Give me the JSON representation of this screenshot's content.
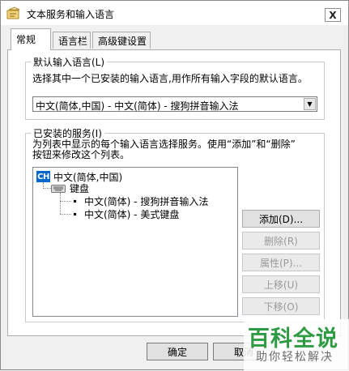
{
  "window": {
    "title": "文本服务和输入语言",
    "close_glyph": "X"
  },
  "tabs": [
    {
      "label": "常规",
      "active": true
    },
    {
      "label": "语言栏",
      "active": false
    },
    {
      "label": "高级键设置",
      "active": false
    }
  ],
  "default_language": {
    "legend": "默认输入语言(L)",
    "description": "选择其中一个已安装的输入语言,用作所有输入字段的默认语言。",
    "selected": "中文(简体,中国) - 中文(简体) - 搜狗拼音输入法"
  },
  "installed_services": {
    "legend": "已安装的服务(I)",
    "description_line1": "为列表中显示的每个输入语言选择服务。使用“添加”和“删除”",
    "description_line2": "按钮来修改这个列表。",
    "tree": {
      "language_badge": "CH",
      "language_label": "中文(简体,中国)",
      "category_label": "键盘",
      "services": [
        "中文(简体) - 搜狗拼音输入法",
        "中文(简体) - 美式键盘"
      ]
    },
    "buttons": {
      "add": "添加(D)...",
      "remove": "删除(R)",
      "properties": "属性(P)...",
      "move_up": "上移(U)",
      "move_down": "下移(O)"
    }
  },
  "footer": {
    "ok": "确定",
    "cancel": "取消"
  },
  "watermark": {
    "logo": "百科全说",
    "slogan": "助你轻松解决",
    "color": "#2e9b43"
  },
  "colors": {
    "selection_blue": "#0066cc",
    "window_bg": "#f0f0f0"
  }
}
